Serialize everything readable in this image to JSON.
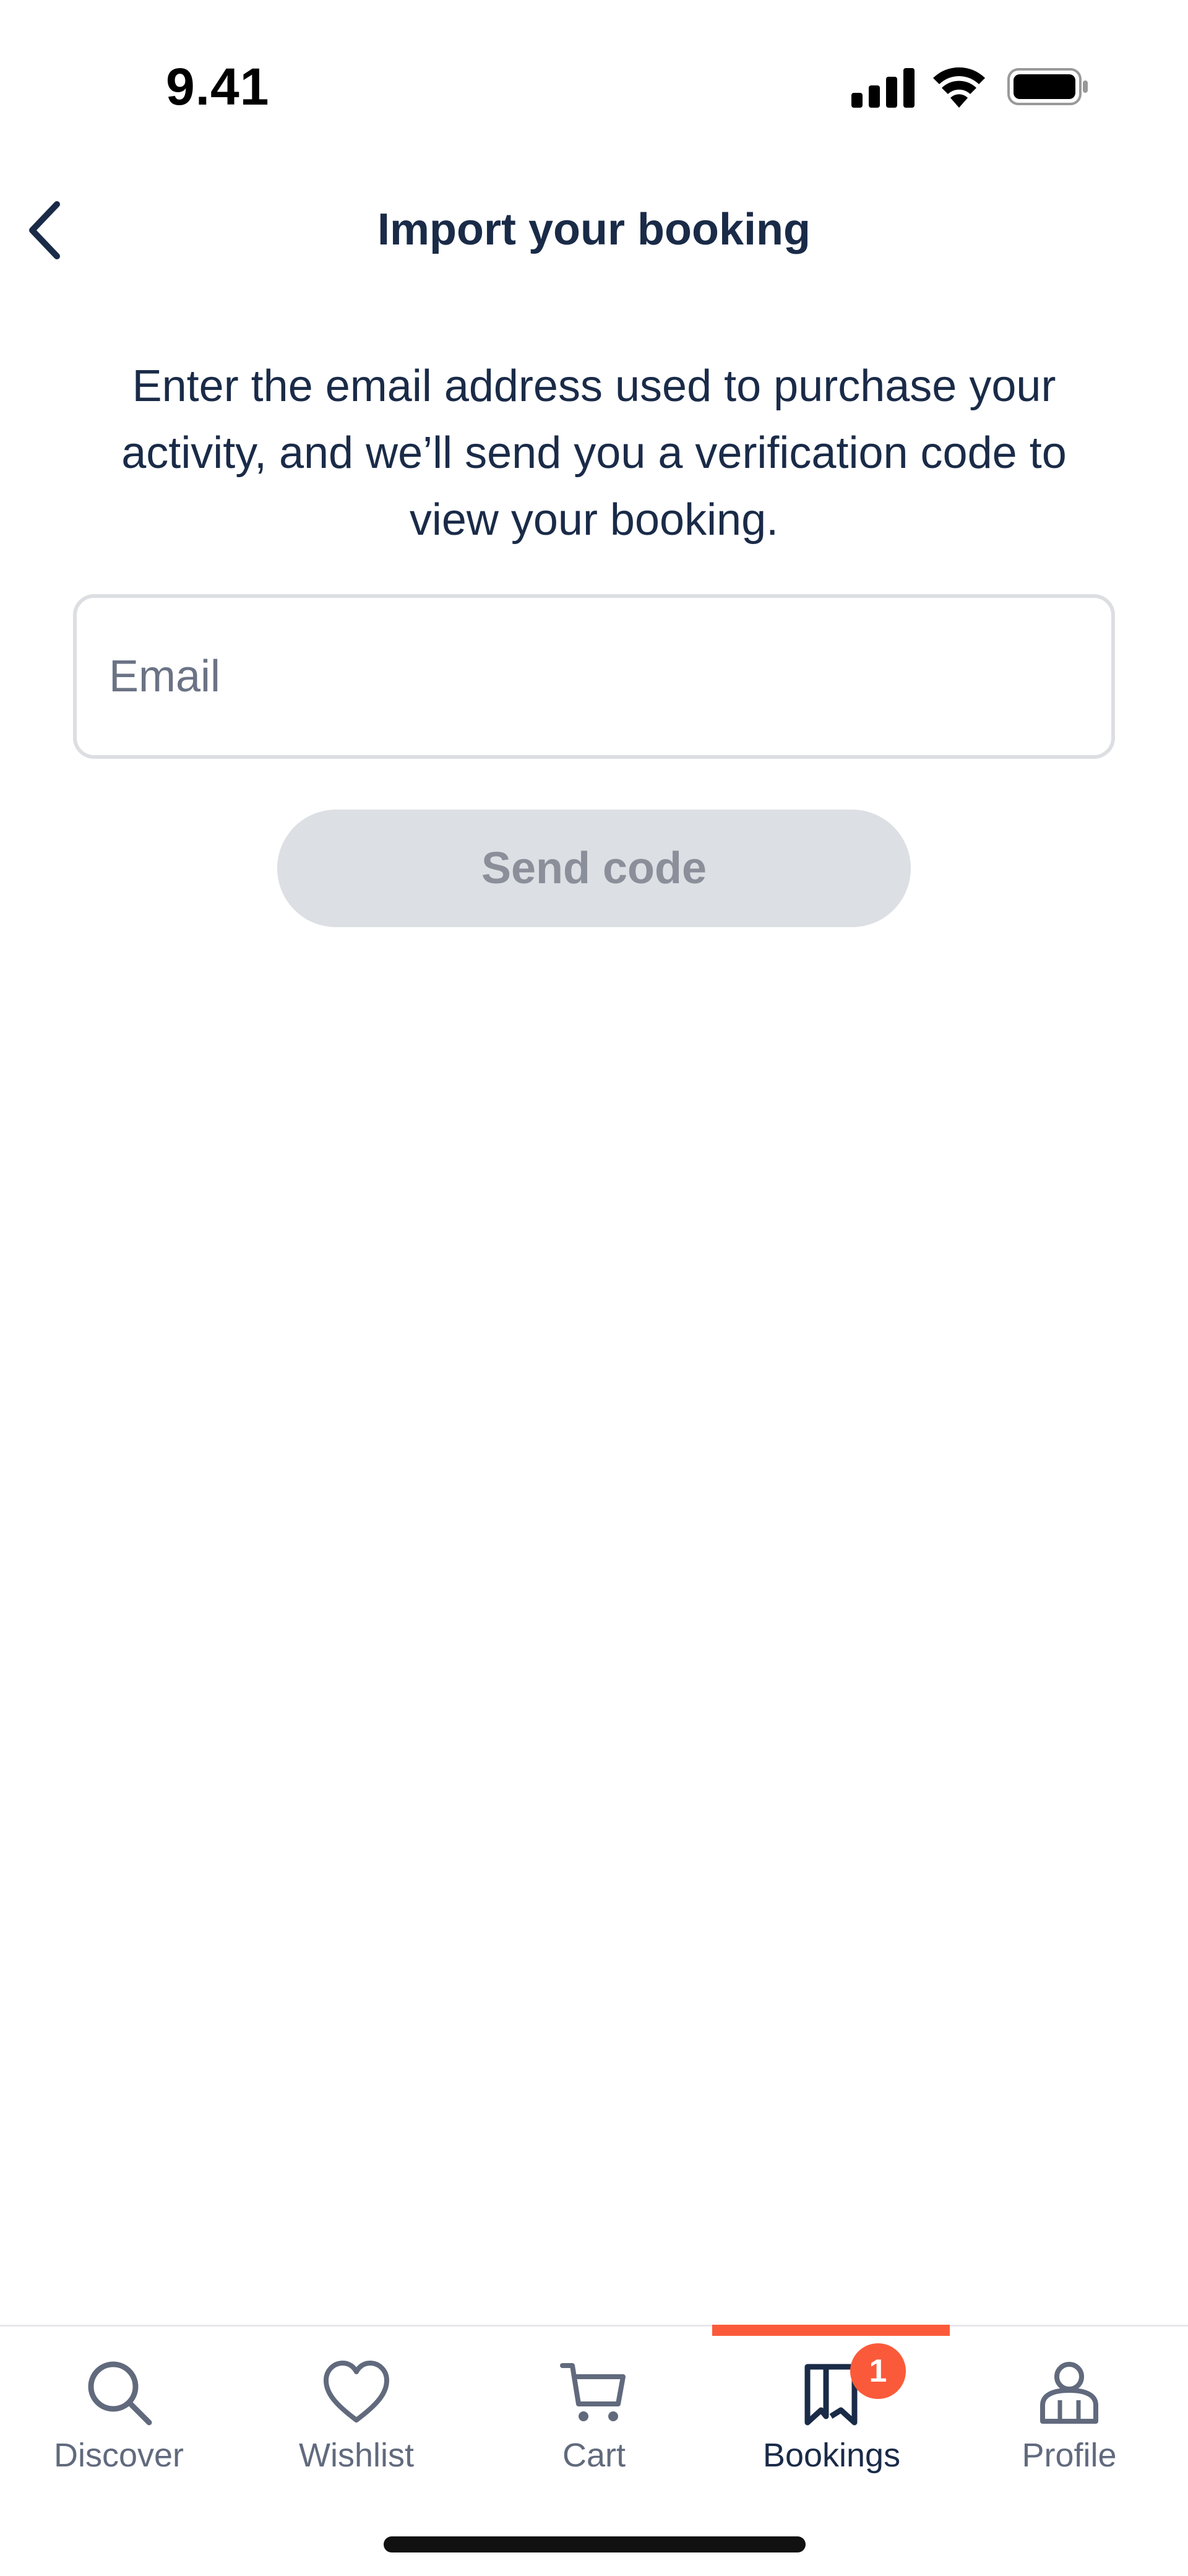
{
  "status_bar": {
    "time": "9.41",
    "icons": [
      "cellular-signal-icon",
      "wifi-icon",
      "battery-icon"
    ]
  },
  "header": {
    "back_icon": "chevron-left-icon",
    "title": "Import your booking"
  },
  "main": {
    "description": "Enter the email address used to purchase your activity, and we’ll send you a verification code to view your booking.",
    "email": {
      "placeholder": "Email",
      "value": ""
    },
    "send_button": {
      "label": "Send code",
      "disabled": true
    }
  },
  "tab_bar": {
    "items": [
      {
        "label": "Discover",
        "icon": "search-icon",
        "active": false
      },
      {
        "label": "Wishlist",
        "icon": "heart-icon",
        "active": false
      },
      {
        "label": "Cart",
        "icon": "cart-icon",
        "active": false
      },
      {
        "label": "Bookings",
        "icon": "bookmark-icon",
        "active": true,
        "badge": "1"
      },
      {
        "label": "Profile",
        "icon": "profile-icon",
        "active": false
      }
    ]
  },
  "colors": {
    "text": "#1a2b48",
    "accent": "#fb5a3a",
    "disabled_button_bg": "#dcdfe3",
    "disabled_button_text": "#8a8f9a",
    "inactive_tab": "#616a7d"
  }
}
